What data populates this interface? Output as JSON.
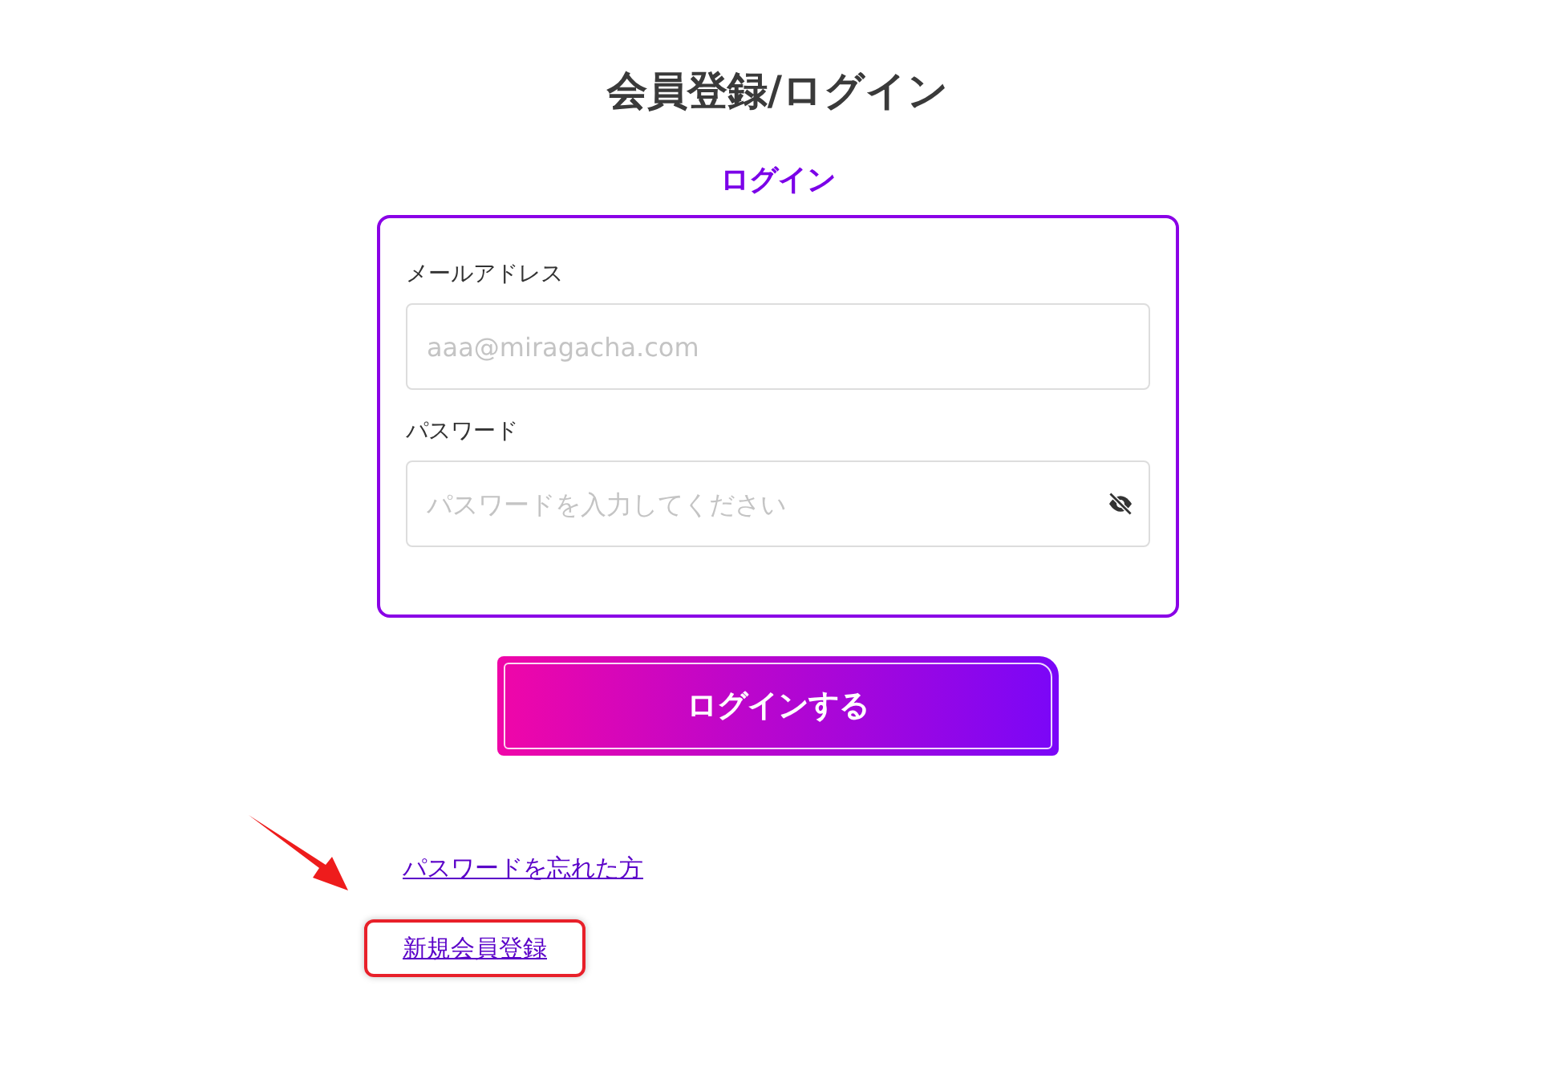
{
  "page": {
    "title": "会員登録/ログイン"
  },
  "login": {
    "heading": "ログイン",
    "fields": [
      {
        "kind": "email",
        "label": "メールアドレス",
        "placeholder": "aaa@miragacha.com"
      },
      {
        "kind": "password",
        "label": "パスワード",
        "placeholder": "パスワードを入力してください"
      }
    ],
    "submit": "ログインする"
  },
  "links": [
    {
      "label": "パスワードを忘れた方",
      "highlighted": false
    },
    {
      "label": "新規会員登録",
      "highlighted": true
    }
  ]
}
